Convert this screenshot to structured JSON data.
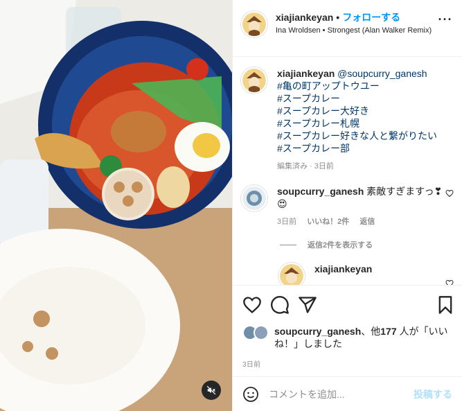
{
  "post": {
    "username": "xiajiankeyan",
    "separator": "•",
    "follow_label": "フォローする",
    "audio": "Ina Wroldsen • Strongest (Alan Walker Remix)",
    "more_label": "···"
  },
  "caption": {
    "username": "xiajiankeyan",
    "mention": "@soupcurry_ganesh",
    "hashtags": [
      "#亀の町アップトウユー",
      "#スープカレー",
      "#スープカレー大好き",
      "#スープカレー札幌",
      "#スープカレー好きな人と繋がりたい",
      "#スープカレー部"
    ],
    "meta": "編集済み · 3日前"
  },
  "comment": {
    "username": "soupcurry_ganesh",
    "text": "素敵すぎますっ❣",
    "emoji": "😍",
    "time": "3日前",
    "likes": "いいね！2件",
    "reply": "返信"
  },
  "view_replies": "返信2件を表示する",
  "reply_preview": {
    "username": "xiajiankeyan"
  },
  "likes": {
    "user": "soupcurry_ganesh",
    "text_mid": "、他",
    "count": "177",
    "text_end": "人が「いいね！」しました"
  },
  "timestamp": "3日前",
  "add_comment": {
    "placeholder": "コメントを追加...",
    "post_label": "投稿する"
  },
  "colors": {
    "link": "#0095f6",
    "hashtag": "#00376b",
    "muted": "#8e8e8e",
    "bowl": "#0f2a5c"
  }
}
